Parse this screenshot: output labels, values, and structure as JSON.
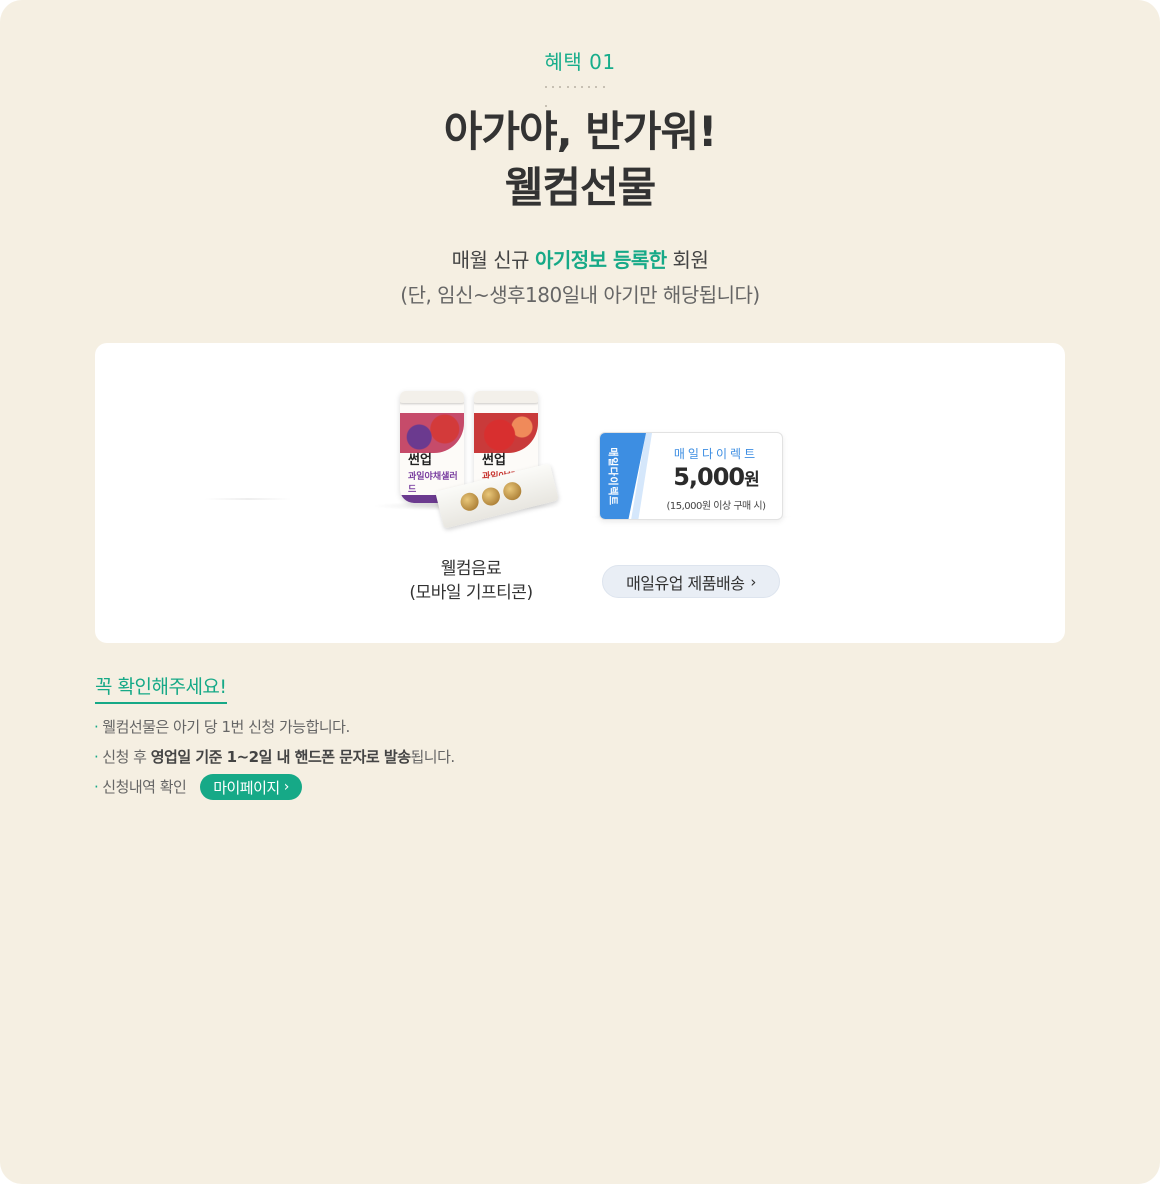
{
  "header": {
    "eyebrow": "혜택 01",
    "title_line1": "아가야, 반가워!",
    "title_line2": "웰컴선물"
  },
  "description": {
    "line1_prefix": "매월 신규 ",
    "line1_highlight": "아기정보 등록한",
    "line1_suffix": " 회원",
    "line2": "(단, 임신~생후180일내 아기만 해당됩니다)"
  },
  "gift_card": {
    "drink": {
      "cup_brand": "썬업",
      "cup_sub": "과일야채샐러드",
      "label_line1": "웰컴음료",
      "label_line2": "(모바일 기프티콘)"
    },
    "coupon": {
      "side_text": "매일다이렉트",
      "brand": "매일다이렉트",
      "amount": "5,000",
      "unit": "원",
      "condition": "(15,000원 이상 구매 시)"
    },
    "delivery_button": "매일유업 제품배송"
  },
  "notice": {
    "title": "꼭 확인해주세요!",
    "bullet": "·",
    "note1": "웰컴선물은 아기 당 1번 신청 가능합니다.",
    "note2_prefix": "신청 후 ",
    "note2_bold": "영업일 기준 1~2일 내 핸드폰 문자로 발송",
    "note2_suffix": "됩니다.",
    "note3": "신청내역 확인",
    "mypage_button": "마이페이지"
  },
  "colors": {
    "background": "#f5efe2",
    "accent_green": "#16a987",
    "coupon_blue": "#3d8ee2"
  },
  "icons": {
    "chevron": "chevron-right-icon"
  }
}
